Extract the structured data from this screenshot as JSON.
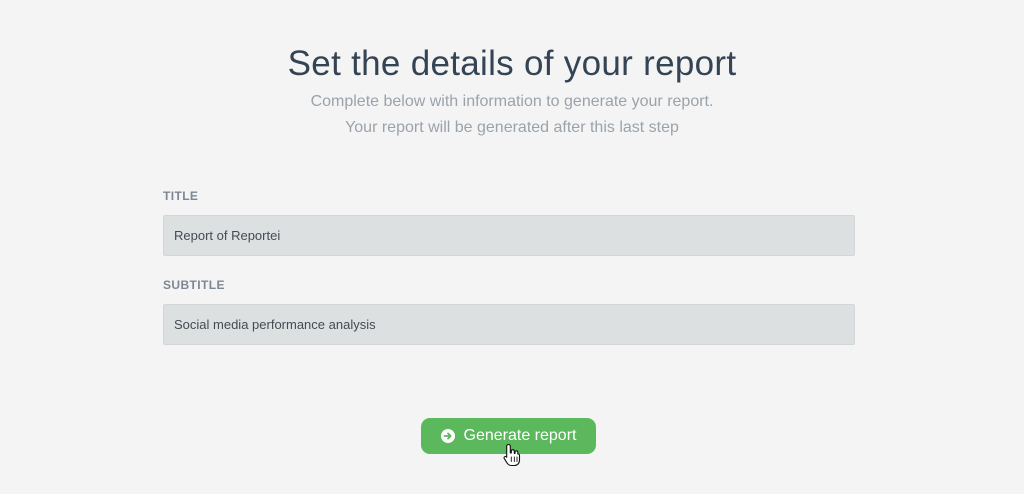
{
  "header": {
    "title": "Set the details of your report",
    "subtitle_line1": "Complete below with information to generate your report.",
    "subtitle_line2": "Your report will be generated after this last step"
  },
  "form": {
    "title_label": "TITLE",
    "title_value": "Report of Reportei",
    "subtitle_label": "SUBTITLE",
    "subtitle_value": "Social media performance analysis"
  },
  "actions": {
    "generate_label": "Generate report",
    "generate_icon": "arrow-circle-right-icon"
  },
  "colors": {
    "background": "#f4f4f4",
    "title_text": "#344454",
    "muted_text": "#9aa3ab",
    "input_bg": "#dde0e1",
    "button_green": "#5cb85c"
  }
}
